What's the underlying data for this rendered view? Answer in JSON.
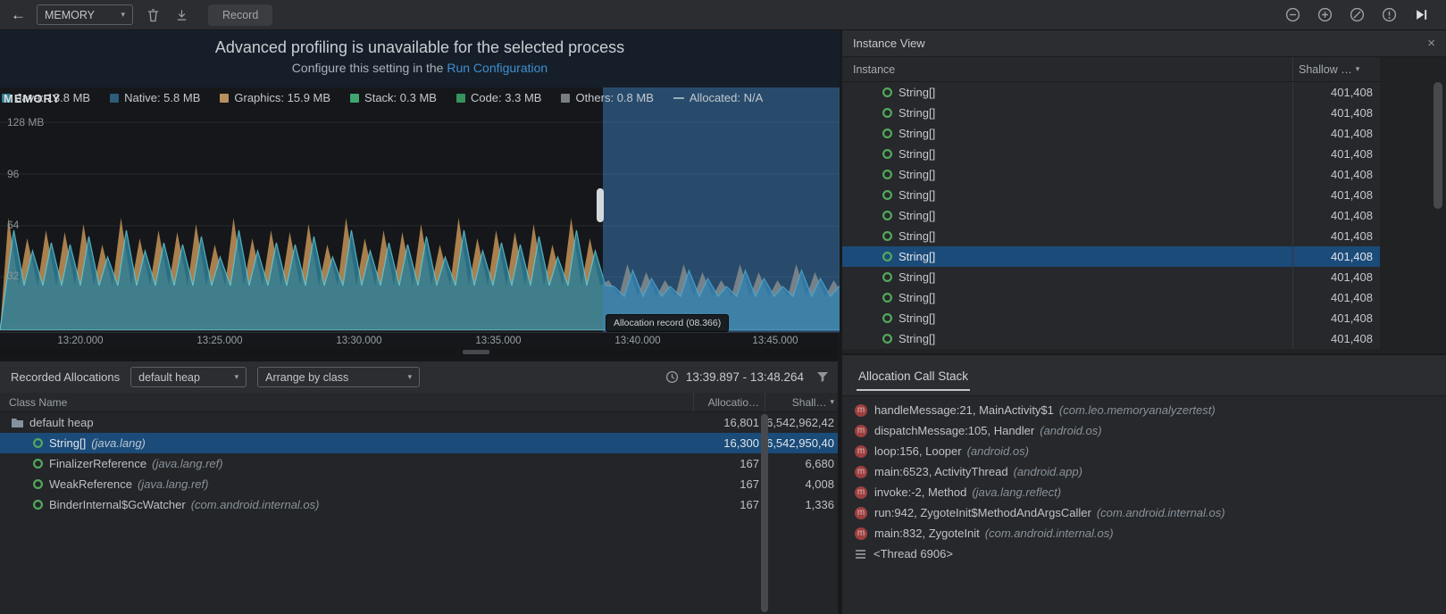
{
  "icons": {
    "back": "←",
    "chevron_down": "▾",
    "close": "×",
    "method_glyph": "m"
  },
  "toolbar": {
    "process_selector": "MEMORY",
    "record_label": "Record"
  },
  "banner": {
    "line1": "Advanced profiling is unavailable for the selected process",
    "line2_prefix": "Configure this setting in the ",
    "line2_link": "Run Configuration"
  },
  "chart": {
    "overlay_label": "MEMORY",
    "legend": [
      {
        "label": "Java: 13.8 MB",
        "swatch": "background:#2e7e96"
      },
      {
        "label": "Native: 5.8 MB",
        "swatch": "background:#2d5d78"
      },
      {
        "label": "Graphics: 15.9 MB",
        "swatch": "background:#b8905d"
      },
      {
        "label": "Stack: 0.3 MB",
        "swatch": "background:#3fa56e"
      },
      {
        "label": "Code: 3.3 MB",
        "swatch": "background:#35935f"
      },
      {
        "label": "Others: 0.8 MB",
        "swatch": "background:#787d82"
      },
      {
        "label": "Allocated: N/A",
        "swatch": "background:transparent;height:0;width:12px;border-top:2px dashed #96abb8;border-radius:0"
      }
    ],
    "y_ticks": [
      "128 MB",
      "96",
      "64",
      "32"
    ],
    "x_ticks": [
      "13:20.000",
      "13:25.000",
      "13:30.000",
      "13:35.000",
      "13:40.000",
      "13:45.000"
    ],
    "tooltip": "Allocation record (08.366)",
    "colors": {
      "java": "#2e7e96",
      "java_stroke": "#59cadd",
      "graphics": "#b68a52",
      "selection": "#3e84c6",
      "link": "#3f8fd1",
      "selected_row": "#1b4b79"
    },
    "wave": {
      "period": 21,
      "base": 276,
      "valley": 226,
      "peak_a": 150,
      "peak_b": 166,
      "peak_step": 7,
      "teal_dx": 6,
      "teal_dy": 14,
      "sel_x": 672,
      "sel_peak": 202,
      "sel_valley": 238,
      "sel_step": 9
    }
  },
  "allocations": {
    "title": "Recorded Allocations",
    "heap_selector": "default heap",
    "arrange_selector": "Arrange by class",
    "time_range": "13:39.897 - 13:48.264",
    "columns": {
      "name": "Class Name",
      "alloc": "Allocatio…",
      "shallow": "Shall…"
    },
    "selected_index": 1,
    "rows": [
      {
        "name": "default heap",
        "pkg": "",
        "allocations": "16,801",
        "shallow": "6,542,962,42",
        "type": "heap"
      },
      {
        "name": "String[]",
        "pkg": "(java.lang)",
        "allocations": "16,300",
        "shallow": "6,542,950,40",
        "type": "class"
      },
      {
        "name": "FinalizerReference",
        "pkg": "(java.lang.ref)",
        "allocations": "167",
        "shallow": "6,680",
        "type": "class"
      },
      {
        "name": "WeakReference",
        "pkg": "(java.lang.ref)",
        "allocations": "167",
        "shallow": "4,008",
        "type": "class"
      },
      {
        "name": "BinderInternal$GcWatcher",
        "pkg": "(com.android.internal.os)",
        "allocations": "167",
        "shallow": "1,336",
        "type": "class"
      }
    ]
  },
  "instance_view": {
    "title": "Instance View",
    "col_instance": "Instance",
    "col_shallow": "Shallow …",
    "selected_index": 8,
    "rows": [
      {
        "label": "String[]",
        "value": "401,408"
      },
      {
        "label": "String[]",
        "value": "401,408"
      },
      {
        "label": "String[]",
        "value": "401,408"
      },
      {
        "label": "String[]",
        "value": "401,408"
      },
      {
        "label": "String[]",
        "value": "401,408"
      },
      {
        "label": "String[]",
        "value": "401,408"
      },
      {
        "label": "String[]",
        "value": "401,408"
      },
      {
        "label": "String[]",
        "value": "401,408"
      },
      {
        "label": "String[]",
        "value": "401,408"
      },
      {
        "label": "String[]",
        "value": "401,408"
      },
      {
        "label": "String[]",
        "value": "401,408"
      },
      {
        "label": "String[]",
        "value": "401,408"
      },
      {
        "label": "String[]",
        "value": "401,408"
      }
    ]
  },
  "call_stack": {
    "title": "Allocation Call Stack",
    "frames": [
      {
        "text": "handleMessage:21, MainActivity$1",
        "pkg": "(com.leo.memoryanalyzertest)",
        "icon": "method"
      },
      {
        "text": "dispatchMessage:105, Handler",
        "pkg": "(android.os)",
        "icon": "method"
      },
      {
        "text": "loop:156, Looper",
        "pkg": "(android.os)",
        "icon": "method"
      },
      {
        "text": "main:6523, ActivityThread",
        "pkg": "(android.app)",
        "icon": "method"
      },
      {
        "text": "invoke:-2, Method",
        "pkg": "(java.lang.reflect)",
        "icon": "method"
      },
      {
        "text": "run:942, ZygoteInit$MethodAndArgsCaller",
        "pkg": "(com.android.internal.os)",
        "icon": "method"
      },
      {
        "text": "main:832, ZygoteInit",
        "pkg": "(com.android.internal.os)",
        "icon": "method"
      },
      {
        "text": "<Thread 6906>",
        "pkg": "",
        "icon": "thread"
      }
    ]
  }
}
